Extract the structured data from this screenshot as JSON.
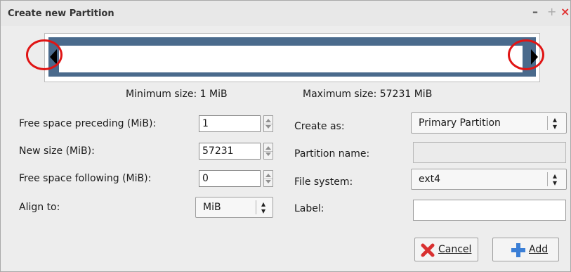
{
  "window": {
    "title": "Create new Partition",
    "minimize_label": "–",
    "maximize_label": "+",
    "close_label": "×"
  },
  "size_info": {
    "minimum": "Minimum size: 1 MiB",
    "maximum": "Maximum size: 57231 MiB"
  },
  "left_form": {
    "free_preceding_label": "Free space preceding (MiB):",
    "free_preceding_value": "1",
    "new_size_label": "New size (MiB):",
    "new_size_value": "57231",
    "free_following_label": "Free space following (MiB):",
    "free_following_value": "0",
    "align_label": "Align to:",
    "align_value": "MiB"
  },
  "right_form": {
    "create_as_label": "Create as:",
    "create_as_value": "Primary Partition",
    "partition_name_label": "Partition name:",
    "partition_name_value": "",
    "file_system_label": "File system:",
    "file_system_value": "ext4",
    "label_label": "Label:",
    "label_value": ""
  },
  "buttons": {
    "cancel_label": "Cancel",
    "add_label": "Add"
  },
  "colors": {
    "partition_bar": "#4a6a8c",
    "highlight_circle": "#e01515",
    "close_button": "#e03030",
    "cancel_icon": "#d93030",
    "add_icon": "#3b7fd6"
  },
  "icons": {
    "cancel": "red-x-icon",
    "add": "blue-plus-icon",
    "left_handle": "arrow-left-icon",
    "right_handle": "arrow-right-icon"
  }
}
